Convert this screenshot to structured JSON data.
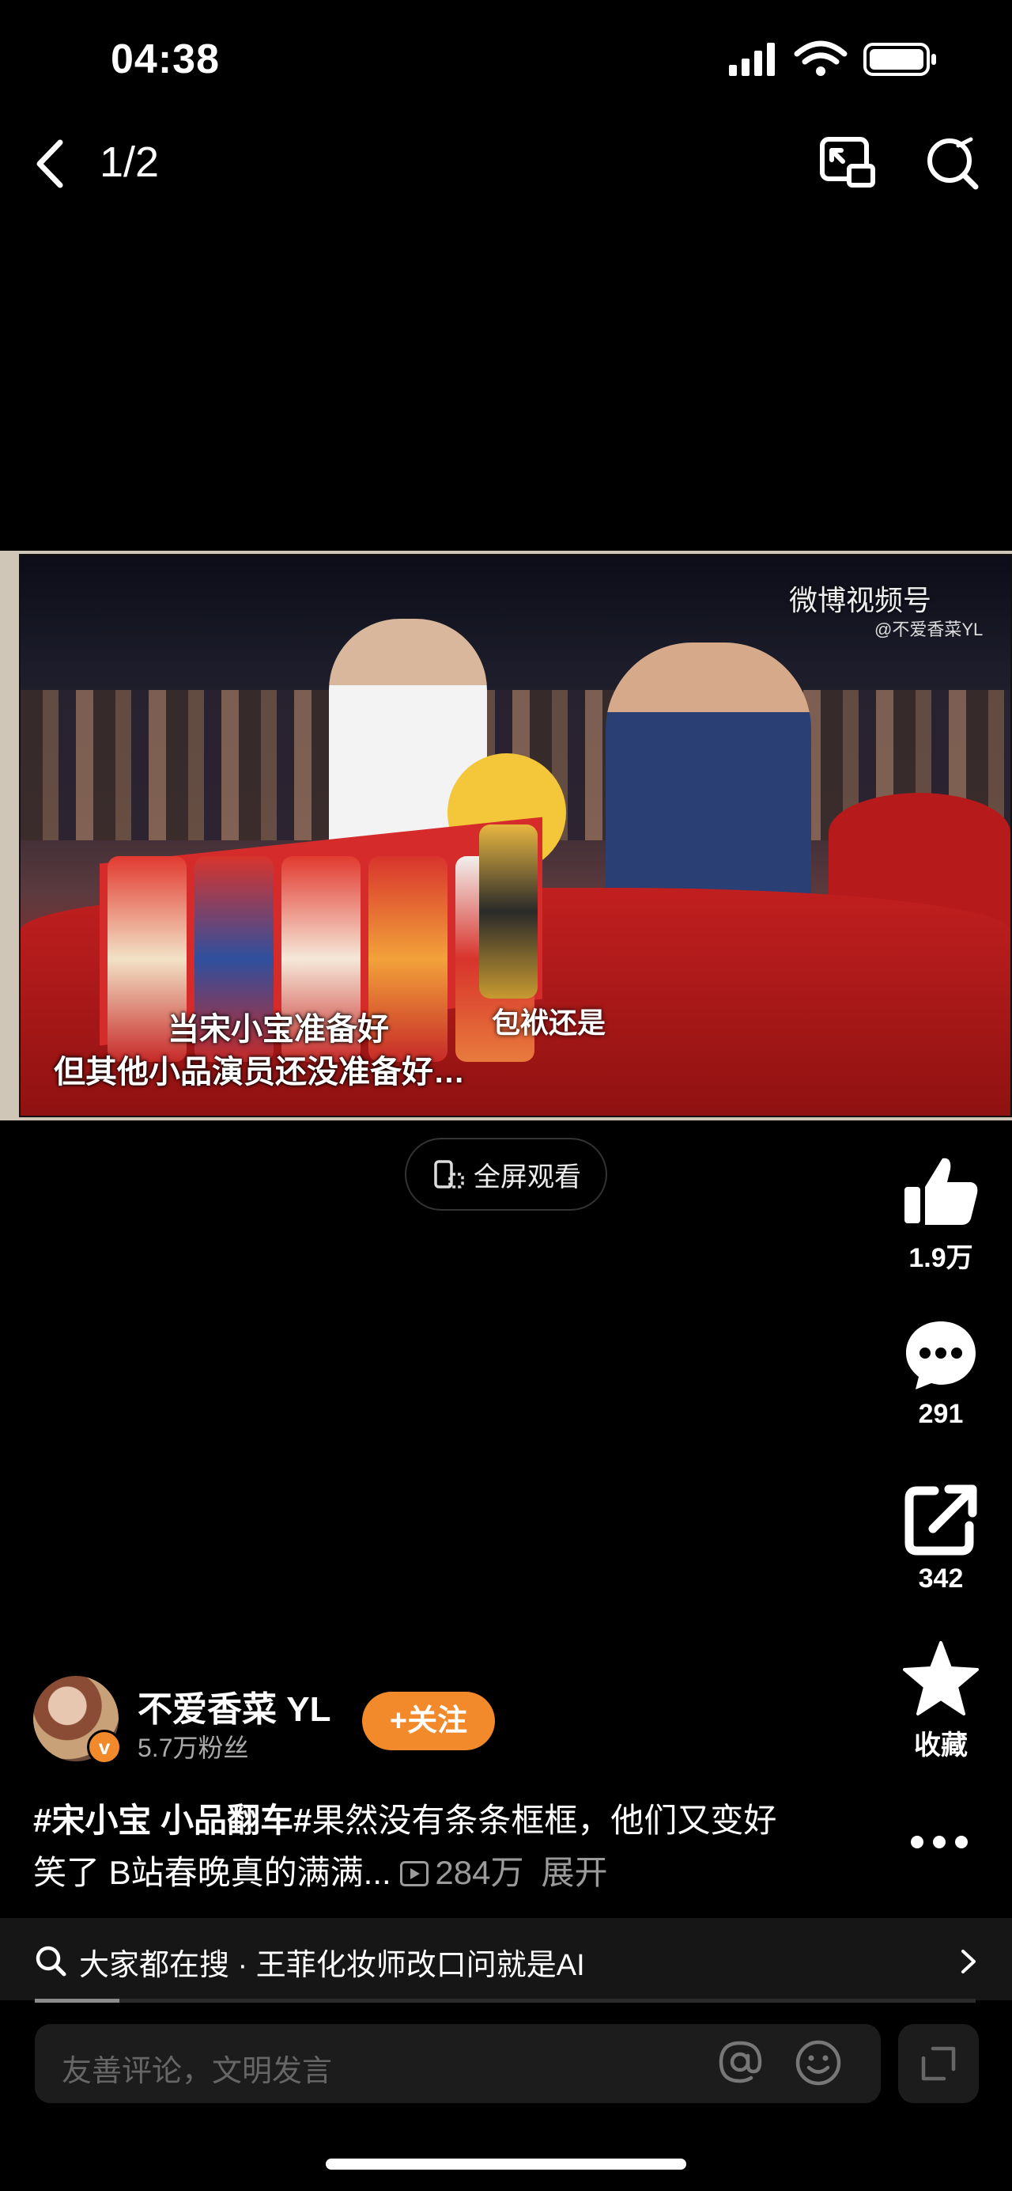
{
  "status_bar": {
    "time": "04:38"
  },
  "nav": {
    "page_count": "1/2"
  },
  "video": {
    "caption_line1": "当宋小宝准备好",
    "caption_line2": "但其他小品演员还没准备好…",
    "caption_side": "包袱还是",
    "watermark": "微博视频号",
    "watermark_sub": "@不爱香菜YL"
  },
  "fullscreen_label": "全屏观看",
  "actions": {
    "like_count": "1.9万",
    "comment_count": "291",
    "share_count": "342",
    "favorite_label": "收藏"
  },
  "author": {
    "name": "不爱香菜 YL",
    "fans": "5.7万粉丝",
    "follow_label": "+关注",
    "badge": "v"
  },
  "description": {
    "hashtag": "#宋小宝 小品翻车#",
    "text": "果然没有条条框框，他们又变好笑了 B站春晚真的满满...",
    "views": "284万",
    "expand": "展开"
  },
  "hot_search": {
    "text": "大家都在搜 · 王菲化妆师改口问就是AI",
    "progress": 0.09
  },
  "comment_input": {
    "placeholder": "友善评论，文明发言"
  }
}
